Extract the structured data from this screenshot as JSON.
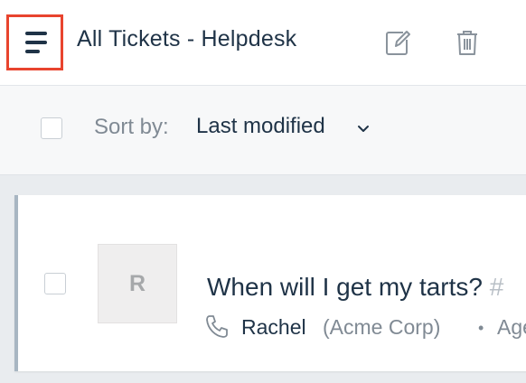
{
  "header": {
    "menu_icon": "hamburger-menu-icon",
    "title": "All Tickets - Helpdesk",
    "edit_icon": "edit-icon",
    "trash_icon": "trash-icon"
  },
  "toolbar": {
    "sort_label": "Sort by:",
    "sort_value": "Last modified",
    "sort_chevron_icon": "chevron-down-icon"
  },
  "ticket": {
    "avatar_initial": "R",
    "subject": "When will I get my tarts?",
    "ticket_id": "#",
    "channel_icon": "phone-icon",
    "requester": "Rachel",
    "company": "(Acme Corp)",
    "separator": "•",
    "agent_text": "Age"
  },
  "colors": {
    "highlight_border": "#e8442e",
    "primary_text": "#1f3347",
    "muted_text": "#808a94",
    "card_accent": "#a8b6c2"
  }
}
